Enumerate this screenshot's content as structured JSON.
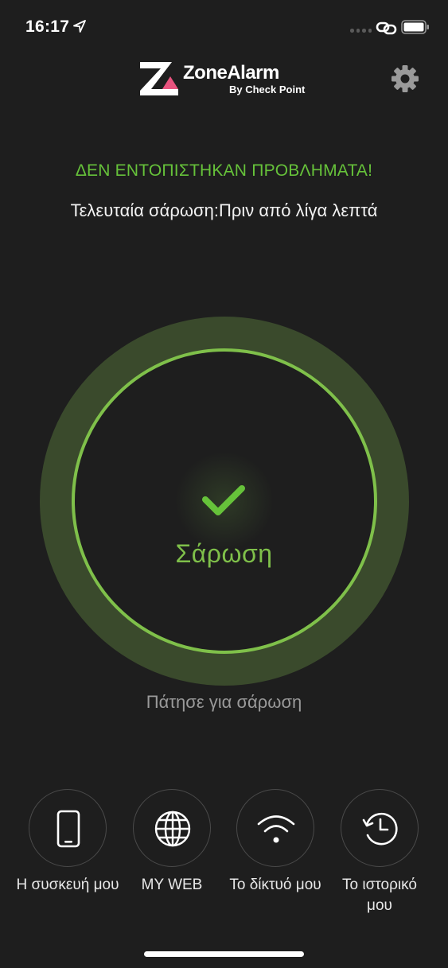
{
  "status_bar": {
    "time": "16:17"
  },
  "header": {
    "logo_name": "ZoneAlarm",
    "logo_sub": "By Check Point"
  },
  "status": {
    "headline": "ΔΕΝ ΕΝΤΟΠΙΣΤΗΚΑΝ ΠΡΟΒΛΗΜΑΤΑ!",
    "last_scan": "Τελευταία σάρωση:Πριν από λίγα λεπτά"
  },
  "scan": {
    "button_label": "Σάρωση",
    "hint": "Πάτησε για σάρωση"
  },
  "nav": {
    "items": [
      {
        "label": "Η συσκευή μου",
        "icon": "phone-icon"
      },
      {
        "label": "MY WEB",
        "icon": "globe-icon"
      },
      {
        "label": "Το δίκτυό μου",
        "icon": "wifi-icon"
      },
      {
        "label": "Το ιστορικό μου",
        "icon": "history-icon"
      }
    ]
  },
  "colors": {
    "background": "#1e1e1e",
    "accent_green": "#66c23a",
    "ring_outer": "#3a4a2c",
    "ring_line": "#7fc04a",
    "logo_pink": "#e8537e"
  }
}
